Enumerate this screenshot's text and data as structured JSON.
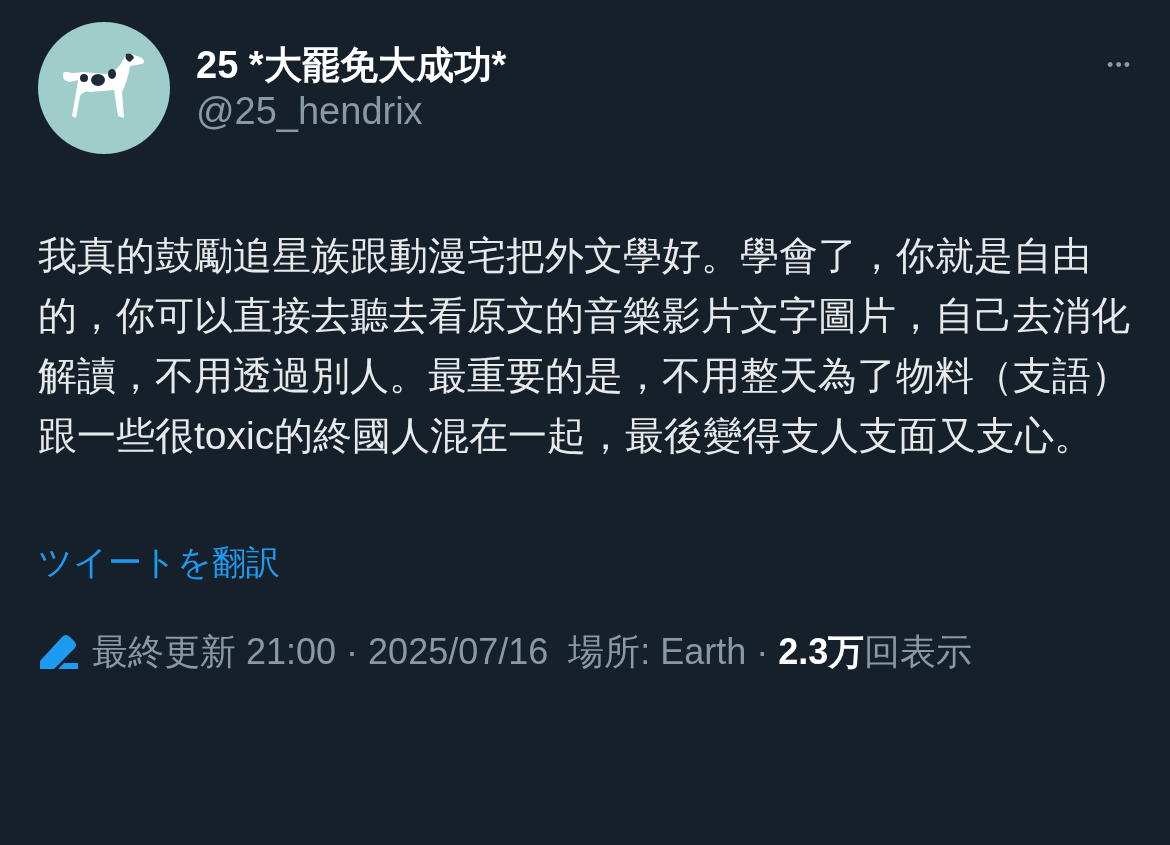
{
  "author": {
    "display_name": "25 *大罷免大成功*",
    "handle": "@25_hendrix"
  },
  "more_button": {
    "label": "•••"
  },
  "tweet_text": "我真的鼓勵追星族跟動漫宅把外文學好。學會了，你就是自由的，你可以直接去聽去看原文的音樂影片文字圖片，自己去消化解讀，不用透過別人。最重要的是，不用整天為了物料（支語）跟一些很toxic的終國人混在一起，最後變得支人支面又支心。",
  "translate_link": "ツイートを翻訳",
  "meta": {
    "edited": true,
    "text": "最終更新 21:00 · 2025/07/16  場所: Earth · **2.3万**回表示"
  }
}
